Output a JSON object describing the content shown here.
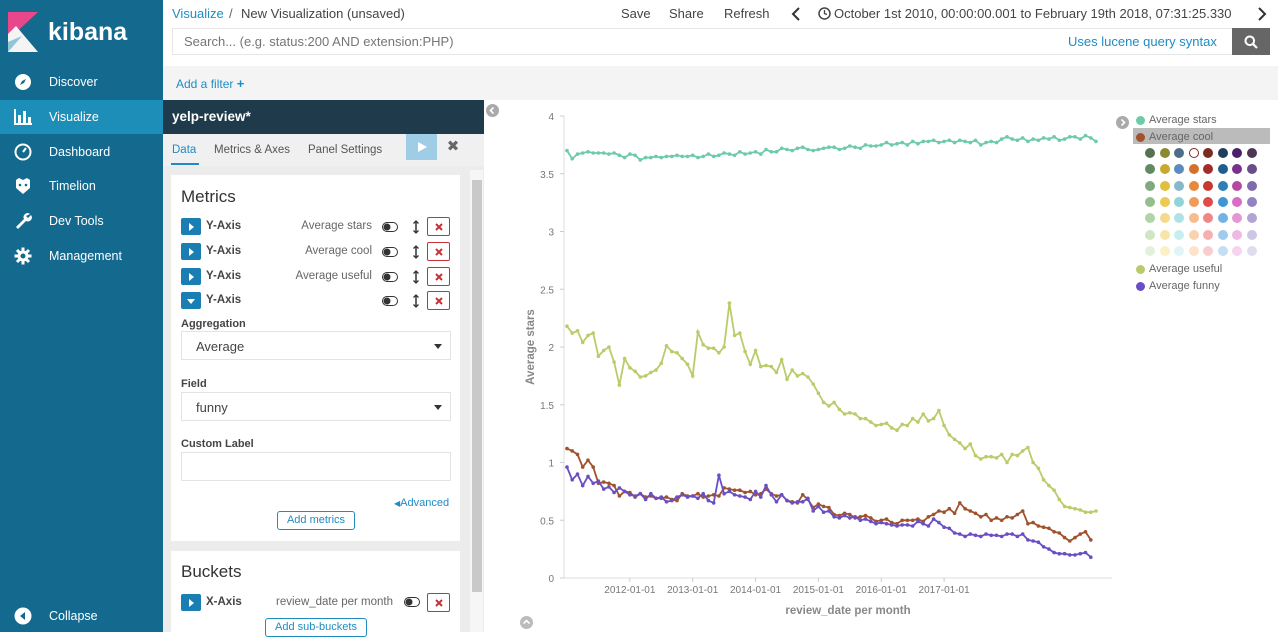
{
  "app": {
    "name": "kibana"
  },
  "sidebar": {
    "items": [
      {
        "label": "Discover",
        "icon": "compass-icon"
      },
      {
        "label": "Visualize",
        "icon": "bar-chart-icon",
        "active": true
      },
      {
        "label": "Dashboard",
        "icon": "dashboard-icon"
      },
      {
        "label": "Timelion",
        "icon": "timelion-icon"
      },
      {
        "label": "Dev Tools",
        "icon": "wrench-icon"
      },
      {
        "label": "Management",
        "icon": "gear-icon"
      }
    ],
    "collapse_label": "Collapse"
  },
  "breadcrumb": {
    "parent": "Visualize",
    "separator": "/",
    "current": "New Visualization (unsaved)"
  },
  "toolbar": {
    "save": "Save",
    "share": "Share",
    "refresh": "Refresh",
    "time_range": "October 1st 2010, 00:00:00.001 to February 19th 2018, 07:31:25.330"
  },
  "search": {
    "placeholder": "Search... (e.g. status:200 AND extension:PHP)",
    "value": "",
    "syntax_link": "Uses lucene query syntax"
  },
  "filter": {
    "add_label": "Add a filter"
  },
  "editor": {
    "index_pattern": "yelp-review*",
    "tabs": [
      "Data",
      "Metrics & Axes",
      "Panel Settings"
    ],
    "metrics": {
      "title": "Metrics",
      "rows": [
        {
          "name": "Y-Axis",
          "desc": "Average stars",
          "expanded": false
        },
        {
          "name": "Y-Axis",
          "desc": "Average cool",
          "expanded": false
        },
        {
          "name": "Y-Axis",
          "desc": "Average useful",
          "expanded": false
        },
        {
          "name": "Y-Axis",
          "desc": "",
          "expanded": true
        }
      ],
      "aggregation_label": "Aggregation",
      "aggregation_value": "Average",
      "field_label": "Field",
      "field_value": "funny",
      "custom_label": "Custom Label",
      "custom_value": "",
      "advanced": "Advanced",
      "add_metrics": "Add metrics"
    },
    "buckets": {
      "title": "Buckets",
      "rows": [
        {
          "name": "X-Axis",
          "desc": "review_date per month"
        }
      ],
      "add_sub_buckets": "Add sub-buckets"
    }
  },
  "legend": {
    "items": [
      {
        "label": "Average stars",
        "color": "#6dcba7"
      },
      {
        "label": "Average cool",
        "color": "#a0522d"
      },
      {
        "label": "Average useful",
        "color": "#b9cc6a"
      },
      {
        "label": "Average funny",
        "color": "#6a4fc4"
      }
    ],
    "palette": [
      [
        "#57724f",
        "#8b8a2f",
        "#4e6d8b",
        "#ffffff",
        "#7e2b1f",
        "#1d3e5d",
        "#4a1f6a",
        "#4d3556"
      ],
      [
        "#628a62",
        "#c9a82f",
        "#5d8bbd",
        "#d4702a",
        "#a52b2b",
        "#1f5d8e",
        "#7a2f8f",
        "#6b4c8a"
      ],
      [
        "#7fa97f",
        "#e0be3e",
        "#85b8c9",
        "#e8883b",
        "#c43a2e",
        "#2d7fb8",
        "#b34aa0",
        "#8069ad"
      ],
      [
        "#93bf8b",
        "#ecc955",
        "#90d3d9",
        "#f09b5b",
        "#e04a4a",
        "#3e96d6",
        "#d86cc4",
        "#9482c4"
      ],
      [
        "#b1d3a8",
        "#f4da8a",
        "#aee2e5",
        "#f6bc8d",
        "#f08787",
        "#73b2e2",
        "#e596d7",
        "#b3a4d6"
      ],
      [
        "#cfe5c4",
        "#f8e6a9",
        "#c9eef0",
        "#f9d2b0",
        "#f5b0b0",
        "#a0cbec",
        "#eeb9e4",
        "#cfc5e6"
      ],
      [
        "#e4f0de",
        "#fbf0c8",
        "#e0f5f6",
        "#fbe3cc",
        "#f8cdcd",
        "#c4def3",
        "#f4d4ef",
        "#e1dbf0"
      ]
    ]
  },
  "chart_data": {
    "type": "line",
    "xlabel": "review_date per month",
    "ylabel": "Average stars",
    "ylim": [
      0,
      4
    ],
    "y_ticks": [
      "0",
      "0.5",
      "1",
      "1.5",
      "2",
      "2.5",
      "3",
      "3.5",
      "4"
    ],
    "x_ticks": [
      "2012-01-01",
      "2013-01-01",
      "2014-01-01",
      "2015-01-01",
      "2016-01-01",
      "2017-01-01"
    ],
    "x_start": "2011-01",
    "x_step": "1 month",
    "series": [
      {
        "name": "Average stars",
        "color": "#6dcba7",
        "values": [
          3.7,
          3.63,
          3.67,
          3.68,
          3.69,
          3.68,
          3.68,
          3.68,
          3.67,
          3.68,
          3.66,
          3.64,
          3.67,
          3.66,
          3.62,
          3.64,
          3.64,
          3.65,
          3.64,
          3.65,
          3.65,
          3.66,
          3.65,
          3.65,
          3.66,
          3.64,
          3.65,
          3.67,
          3.65,
          3.66,
          3.68,
          3.67,
          3.66,
          3.69,
          3.67,
          3.68,
          3.69,
          3.67,
          3.71,
          3.69,
          3.69,
          3.72,
          3.71,
          3.7,
          3.72,
          3.73,
          3.71,
          3.7,
          3.71,
          3.72,
          3.73,
          3.73,
          3.71,
          3.72,
          3.74,
          3.73,
          3.72,
          3.75,
          3.74,
          3.74,
          3.75,
          3.77,
          3.75,
          3.76,
          3.77,
          3.75,
          3.78,
          3.76,
          3.78,
          3.78,
          3.79,
          3.77,
          3.78,
          3.79,
          3.77,
          3.79,
          3.78,
          3.77,
          3.79,
          3.75,
          3.77,
          3.78,
          3.77,
          3.8,
          3.82,
          3.8,
          3.79,
          3.81,
          3.78,
          3.8,
          3.79,
          3.81,
          3.8,
          3.82,
          3.79,
          3.8,
          3.82,
          3.82,
          3.8,
          3.83,
          3.81,
          3.78
        ]
      },
      {
        "name": "Average cool",
        "color": "#a0522d",
        "values": [
          1.12,
          1.1,
          1.07,
          0.96,
          1.02,
          0.96,
          0.82,
          0.83,
          0.82,
          0.8,
          0.71,
          0.75,
          0.74,
          0.7,
          0.73,
          0.7,
          0.71,
          0.69,
          0.69,
          0.7,
          0.68,
          0.67,
          0.73,
          0.71,
          0.71,
          0.73,
          0.7,
          0.71,
          0.72,
          0.71,
          0.78,
          0.77,
          0.76,
          0.76,
          0.74,
          0.75,
          0.72,
          0.73,
          0.77,
          0.73,
          0.71,
          0.72,
          0.67,
          0.66,
          0.65,
          0.72,
          0.68,
          0.61,
          0.64,
          0.62,
          0.61,
          0.55,
          0.54,
          0.56,
          0.55,
          0.52,
          0.53,
          0.54,
          0.52,
          0.49,
          0.5,
          0.51,
          0.48,
          0.47,
          0.5,
          0.5,
          0.5,
          0.51,
          0.49,
          0.53,
          0.55,
          0.58,
          0.57,
          0.6,
          0.56,
          0.65,
          0.6,
          0.58,
          0.56,
          0.53,
          0.55,
          0.5,
          0.52,
          0.5,
          0.53,
          0.52,
          0.55,
          0.58,
          0.47,
          0.48,
          0.45,
          0.44,
          0.43,
          0.4,
          0.39,
          0.35,
          0.32,
          0.35,
          0.38,
          0.4,
          0.33
        ]
      },
      {
        "name": "Average useful",
        "color": "#b9cc6a",
        "values": [
          2.18,
          2.12,
          2.14,
          2.04,
          2.1,
          2.12,
          1.92,
          1.97,
          2.0,
          1.87,
          1.67,
          1.9,
          1.82,
          1.79,
          1.74,
          1.75,
          1.78,
          1.8,
          1.86,
          2.01,
          1.96,
          1.95,
          1.9,
          1.85,
          1.75,
          2.13,
          2.02,
          1.99,
          1.99,
          1.95,
          2.0,
          2.38,
          2.1,
          2.12,
          1.96,
          1.85,
          1.97,
          1.83,
          1.84,
          1.83,
          1.78,
          1.89,
          1.72,
          1.8,
          1.75,
          1.77,
          1.74,
          1.68,
          1.6,
          1.52,
          1.49,
          1.52,
          1.46,
          1.42,
          1.43,
          1.42,
          1.38,
          1.38,
          1.35,
          1.32,
          1.33,
          1.34,
          1.3,
          1.28,
          1.33,
          1.32,
          1.38,
          1.35,
          1.42,
          1.36,
          1.38,
          1.45,
          1.32,
          1.24,
          1.2,
          1.17,
          1.12,
          1.16,
          1.06,
          1.03,
          1.05,
          1.05,
          1.04,
          1.07,
          1.0,
          1.07,
          1.06,
          1.1,
          1.13,
          1.0,
          0.95,
          0.85,
          0.8,
          0.76,
          0.68,
          0.62,
          0.61,
          0.6,
          0.59,
          0.57,
          0.57,
          0.58
        ]
      },
      {
        "name": "Average funny",
        "color": "#6a4fc4",
        "values": [
          0.96,
          0.85,
          0.9,
          0.8,
          0.88,
          0.82,
          0.84,
          0.77,
          0.79,
          0.74,
          0.78,
          0.75,
          0.72,
          0.71,
          0.73,
          0.68,
          0.73,
          0.69,
          0.7,
          0.66,
          0.67,
          0.7,
          0.72,
          0.7,
          0.71,
          0.69,
          0.73,
          0.67,
          0.65,
          0.89,
          0.73,
          0.75,
          0.72,
          0.71,
          0.7,
          0.68,
          0.75,
          0.7,
          0.8,
          0.72,
          0.66,
          0.72,
          0.67,
          0.65,
          0.66,
          0.66,
          0.69,
          0.58,
          0.62,
          0.57,
          0.58,
          0.53,
          0.52,
          0.54,
          0.52,
          0.53,
          0.5,
          0.51,
          0.49,
          0.47,
          0.48,
          0.47,
          0.46,
          0.45,
          0.46,
          0.46,
          0.45,
          0.49,
          0.47,
          0.45,
          0.51,
          0.48,
          0.44,
          0.43,
          0.39,
          0.38,
          0.36,
          0.38,
          0.37,
          0.36,
          0.38,
          0.37,
          0.37,
          0.36,
          0.38,
          0.38,
          0.36,
          0.38,
          0.33,
          0.32,
          0.31,
          0.27,
          0.25,
          0.22,
          0.21,
          0.21,
          0.2,
          0.2,
          0.21,
          0.22,
          0.18
        ]
      }
    ]
  }
}
